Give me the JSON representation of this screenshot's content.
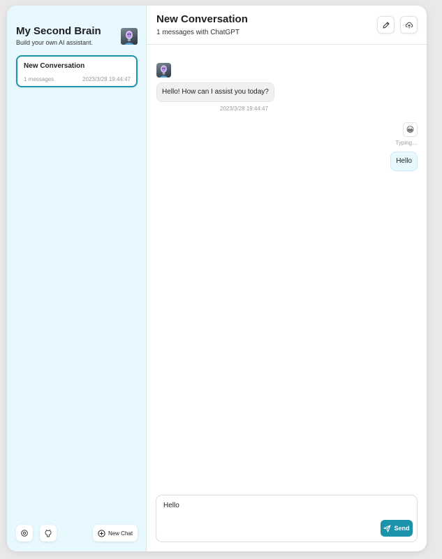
{
  "sidebar": {
    "title": "My Second Brain",
    "subtitle": "Build your own AI assistant.",
    "avatar_icon": "robot-avatar-icon",
    "chats": [
      {
        "title": "New Conversation",
        "count": "1 messages",
        "time": "2023/3/28 19:44:47"
      }
    ],
    "footer": {
      "settings_icon": "gear-icon",
      "github_icon": "github-icon",
      "new_chat_icon": "plus-circle-icon",
      "new_chat_label": "New Chat"
    }
  },
  "chat": {
    "title": "New Conversation",
    "subtitle": "1 messages with ChatGPT",
    "header_buttons": [
      {
        "icon": "rename-icon"
      },
      {
        "icon": "export-icon"
      }
    ],
    "messages": [
      {
        "role": "bot",
        "avatar_icon": "robot-avatar-icon",
        "text": "Hello! How can I assist you today?",
        "time": "2023/3/28 19:44:47"
      },
      {
        "role": "user",
        "avatar": "😀",
        "status": "Typing…",
        "text": "Hello"
      }
    ],
    "composer": {
      "value": "Hello",
      "send_label": "Send",
      "send_icon": "send-icon"
    }
  },
  "colors": {
    "accent": "#1d93ab",
    "sidebar_bg": "#e7f8ff",
    "user_bubble": "#e7f8ff",
    "bot_bubble": "#f0f0f0"
  }
}
